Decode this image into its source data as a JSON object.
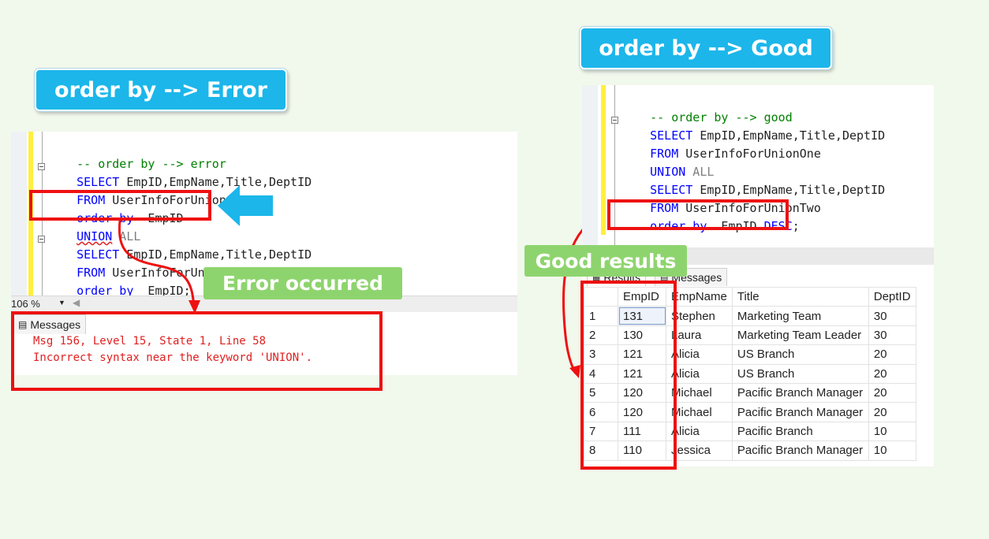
{
  "left": {
    "title": "order by --> Error",
    "code": {
      "comment": "-- order by --> error",
      "select1": {
        "kw": "SELECT",
        "cols": " EmpID,EmpName,Title,DeptID"
      },
      "from1": {
        "kw": "FROM",
        "table": " UserInfoForUnionOne"
      },
      "orderby1": {
        "kw": "order by",
        "col": "  EmpID"
      },
      "union": {
        "kw": "UNION",
        "rest": " ALL"
      },
      "select2": {
        "kw": "SELECT",
        "cols": " EmpID,EmpName,Title,DeptID"
      },
      "from2": {
        "kw": "FROM",
        "table": " UserInfoForUnionTwo"
      },
      "orderby2": {
        "kw": "order by",
        "col": "  EmpID;"
      }
    },
    "error_label": "Error occurred",
    "zoom": "106 %",
    "messages_tab": "Messages",
    "messages": [
      "Msg 156, Level 15, State 1, Line 58",
      "Incorrect syntax near the keyword 'UNION'."
    ]
  },
  "right": {
    "title": "order by --> Good",
    "code": {
      "comment": "-- order by --> good",
      "select1": {
        "kw": "SELECT",
        "cols": " EmpID,EmpName,Title,DeptID"
      },
      "from1": {
        "kw": "FROM",
        "table": " UserInfoForUnionOne"
      },
      "union": {
        "kw": "UNION",
        "rest": " ALL"
      },
      "select2": {
        "kw": "SELECT",
        "cols": " EmpID,EmpName,Title,DeptID"
      },
      "from2": {
        "kw": "FROM",
        "table": " UserInfoForUnionTwo"
      },
      "orderby": {
        "kw": "order by",
        "col": "  EmpID ",
        "desc": "DESC",
        "end": ";"
      }
    },
    "good_label": "Good results",
    "tabs": {
      "results": "Results",
      "messages": "Messages"
    },
    "columns": [
      "EmpID",
      "EmpName",
      "Title",
      "DeptID"
    ],
    "rows": [
      {
        "n": "1",
        "EmpID": "131",
        "EmpName": "Stephen",
        "Title": "Marketing Team",
        "DeptID": "30"
      },
      {
        "n": "2",
        "EmpID": "130",
        "EmpName": "Laura",
        "Title": "Marketing Team Leader",
        "DeptID": "30"
      },
      {
        "n": "3",
        "EmpID": "121",
        "EmpName": "Alicia",
        "Title": "US Branch",
        "DeptID": "20"
      },
      {
        "n": "4",
        "EmpID": "121",
        "EmpName": "Alicia",
        "Title": "US Branch",
        "DeptID": "20"
      },
      {
        "n": "5",
        "EmpID": "120",
        "EmpName": "Michael",
        "Title": "Pacific Branch Manager",
        "DeptID": "20"
      },
      {
        "n": "6",
        "EmpID": "120",
        "EmpName": "Michael",
        "Title": "Pacific Branch Manager",
        "DeptID": "20"
      },
      {
        "n": "7",
        "EmpID": "111",
        "EmpName": "Alicia",
        "Title": "Pacific Branch",
        "DeptID": "10"
      },
      {
        "n": "8",
        "EmpID": "110",
        "EmpName": "Jessica",
        "Title": "Pacific Branch Manager",
        "DeptID": "10"
      }
    ]
  },
  "colors": {
    "accent_blue": "#1cb6ea",
    "label_green": "#8ed46e",
    "highlight_red": "#ee1111",
    "sql_keyword": "#0000ff",
    "sql_comment": "#008000",
    "error_text": "#e02020"
  },
  "icons": {
    "arrow": "left-arrow-icon",
    "messages": "messages-icon",
    "results": "grid-icon"
  }
}
